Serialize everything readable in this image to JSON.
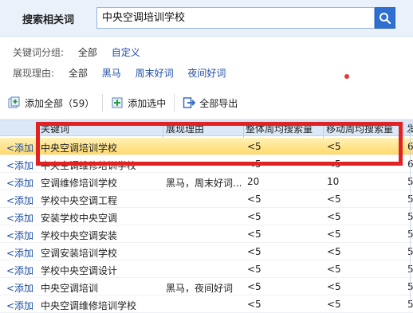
{
  "header": {
    "title": "搜索相关词",
    "search_value": "中央空调培训学校"
  },
  "filters": {
    "group_label": "关键词分组:",
    "group_options": [
      "全部",
      "自定义"
    ],
    "reason_label": "展现理由:",
    "reason_options": [
      "全部",
      "黑马",
      "周末好词",
      "夜间好词"
    ]
  },
  "toolbar": {
    "add_all": "添加全部（59）",
    "add_selected": "添加选中",
    "export_all": "全部导出"
  },
  "table": {
    "columns": [
      "关键词",
      "展现理由",
      "整体周均搜索量",
      "移动周均搜索量",
      "发"
    ],
    "add_label": "<添加",
    "rows": [
      {
        "keyword": "中央空调培训学校",
        "reason": "",
        "total": "<5",
        "mobile": "<5",
        "more": "6",
        "selected": true
      },
      {
        "keyword": "中央空调维修培训学校",
        "reason": "",
        "total": "<5",
        "mobile": "<5",
        "more": "6"
      },
      {
        "keyword": "空调维修培训学校",
        "reason": "黑马，周末好词...",
        "total": "20",
        "mobile": "10",
        "more": "5"
      },
      {
        "keyword": "学校中央空调工程",
        "reason": "",
        "total": "<5",
        "mobile": "<5",
        "more": "5"
      },
      {
        "keyword": "安装学校中央空调",
        "reason": "",
        "total": "<5",
        "mobile": "<5",
        "more": "5"
      },
      {
        "keyword": "学校中央空调安装",
        "reason": "",
        "total": "<5",
        "mobile": "<5",
        "more": "5"
      },
      {
        "keyword": "空调安装培训学校",
        "reason": "",
        "total": "<5",
        "mobile": "<5",
        "more": "5"
      },
      {
        "keyword": "学校中央空调设计",
        "reason": "",
        "total": "<5",
        "mobile": "<5",
        "more": "5"
      },
      {
        "keyword": "中央空调培训",
        "reason": "黑马，夜间好词",
        "total": "<5",
        "mobile": "<5",
        "more": "5"
      },
      {
        "keyword": "中央空调维修培训学校",
        "reason": "",
        "total": "<5",
        "mobile": "<5",
        "more": "5"
      }
    ]
  },
  "colors": {
    "accent": "#2f6fcf",
    "link": "#1f4fa8",
    "highlight_box": "#e02222",
    "selected_row": "#ffd96b"
  }
}
